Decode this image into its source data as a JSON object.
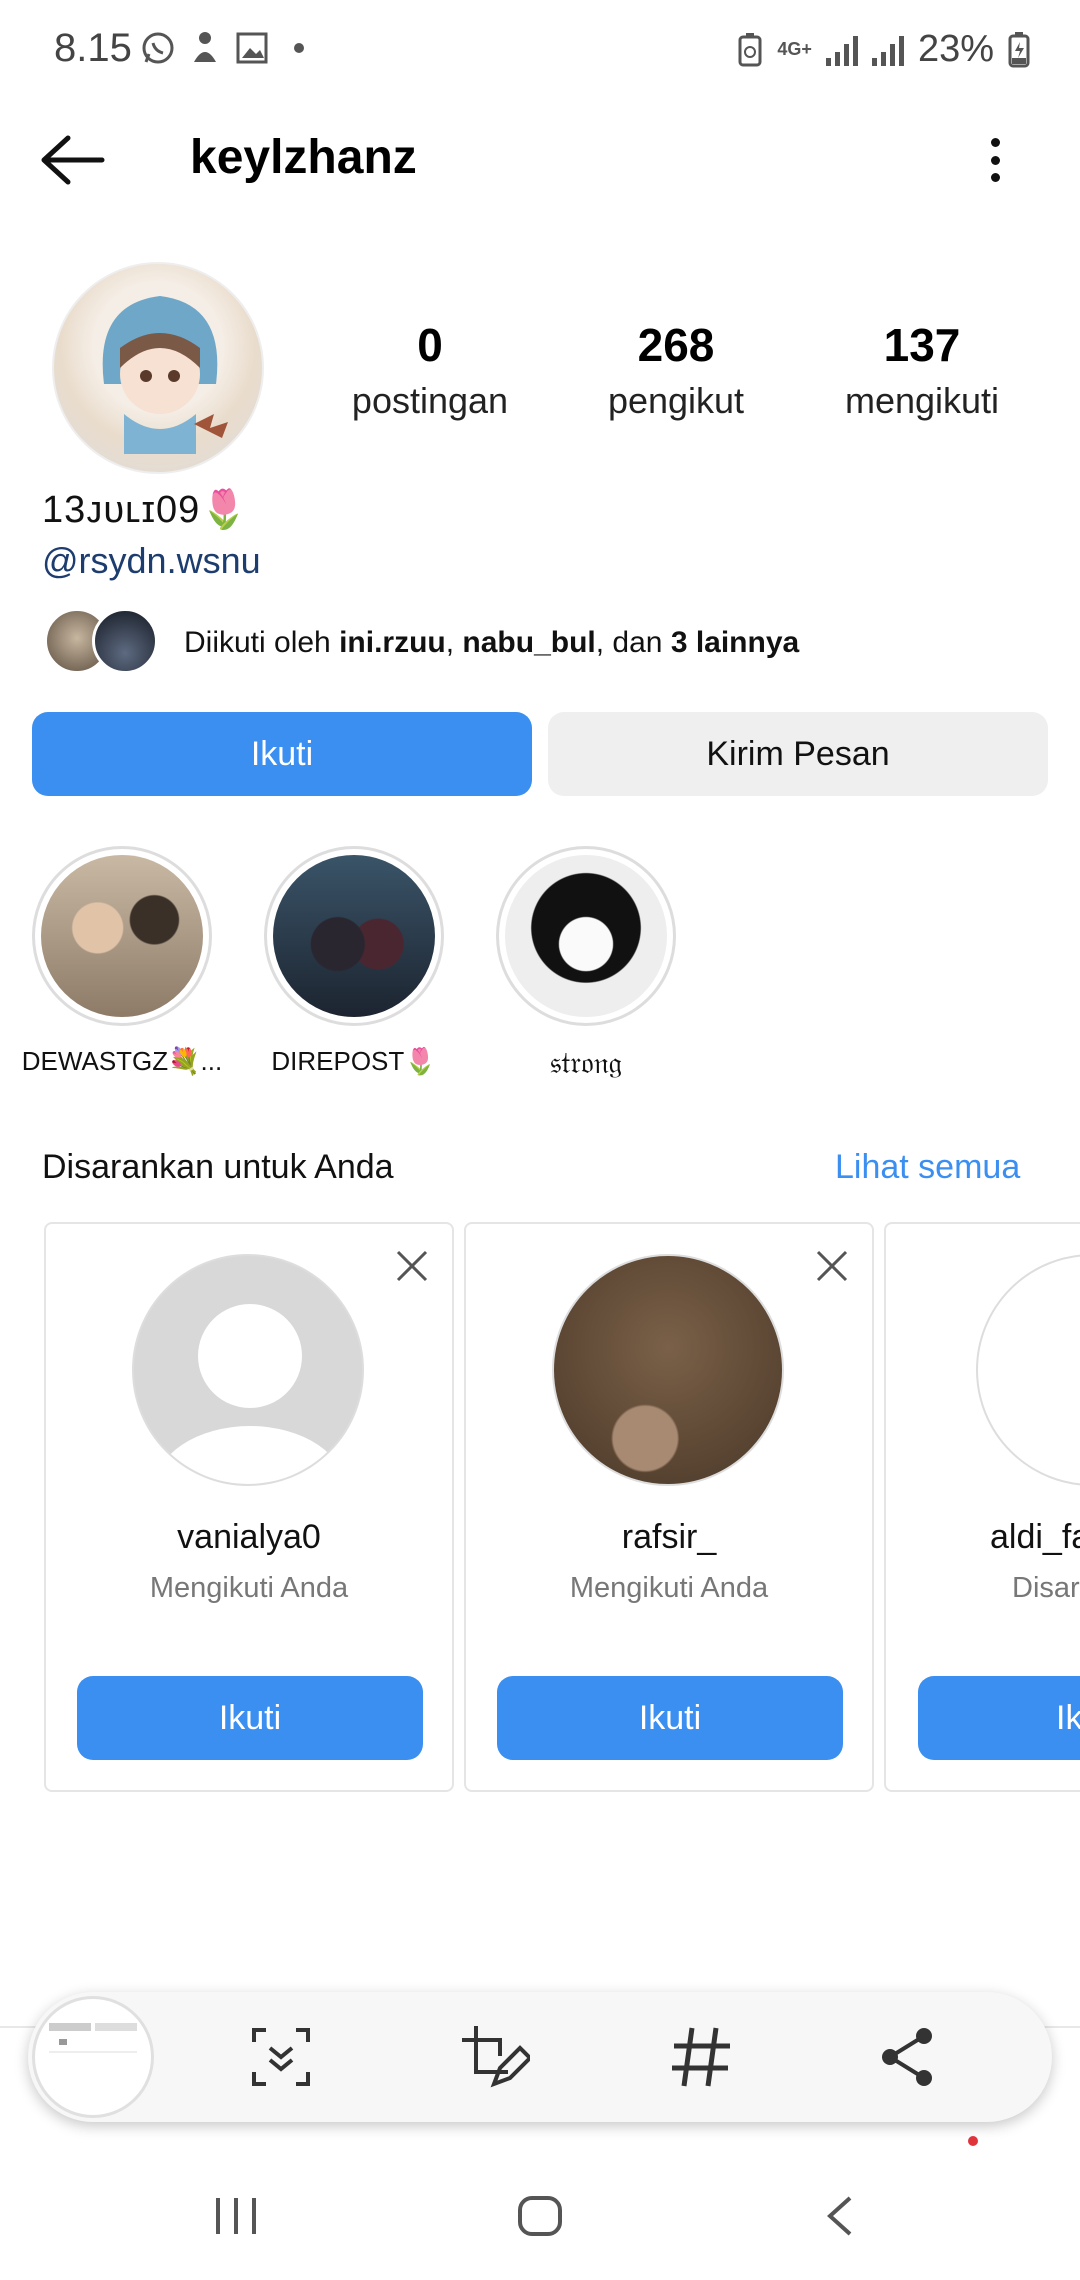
{
  "status_bar": {
    "time": "8.15",
    "network": "4G+",
    "battery": "23%"
  },
  "header": {
    "username": "keylzhanz"
  },
  "profile": {
    "stats": [
      {
        "value": "0",
        "label": "postingan"
      },
      {
        "value": "268",
        "label": "pengikut"
      },
      {
        "value": "137",
        "label": "mengikuti"
      }
    ],
    "bio_name": "13ᴊᴜʟɪ09🌷",
    "bio_link": "@rsydn.wsnu",
    "followed_by": {
      "prefix": "Diikuti oleh ",
      "user1": "ini.rzuu",
      "sep": ", ",
      "user2": "nabu_bul",
      "mid": ", dan ",
      "others": "3 lainnya"
    }
  },
  "actions": {
    "follow": "Ikuti",
    "message": "Kirim Pesan"
  },
  "highlights": [
    {
      "label": "DEWASTGZ💐..."
    },
    {
      "label": "DIREPOST🌷"
    },
    {
      "label": "𝔰𝔱𝔯𝔬𝔫𝔤"
    }
  ],
  "suggestions": {
    "title": "Disarankan untuk Anda",
    "see_all": "Lihat semua",
    "cards": [
      {
        "username": "vanialya0",
        "subtitle": "Mengikuti Anda",
        "button": "Ikuti"
      },
      {
        "username": "rafsir_",
        "subtitle": "Mengikuti Anda",
        "button": "Ikuti"
      },
      {
        "username": "aldi_fa",
        "subtitle": "Disarankan",
        "button": "Ikuti"
      }
    ]
  },
  "colors": {
    "accent": "#3b8ff0",
    "link": "#1d3d6e"
  }
}
